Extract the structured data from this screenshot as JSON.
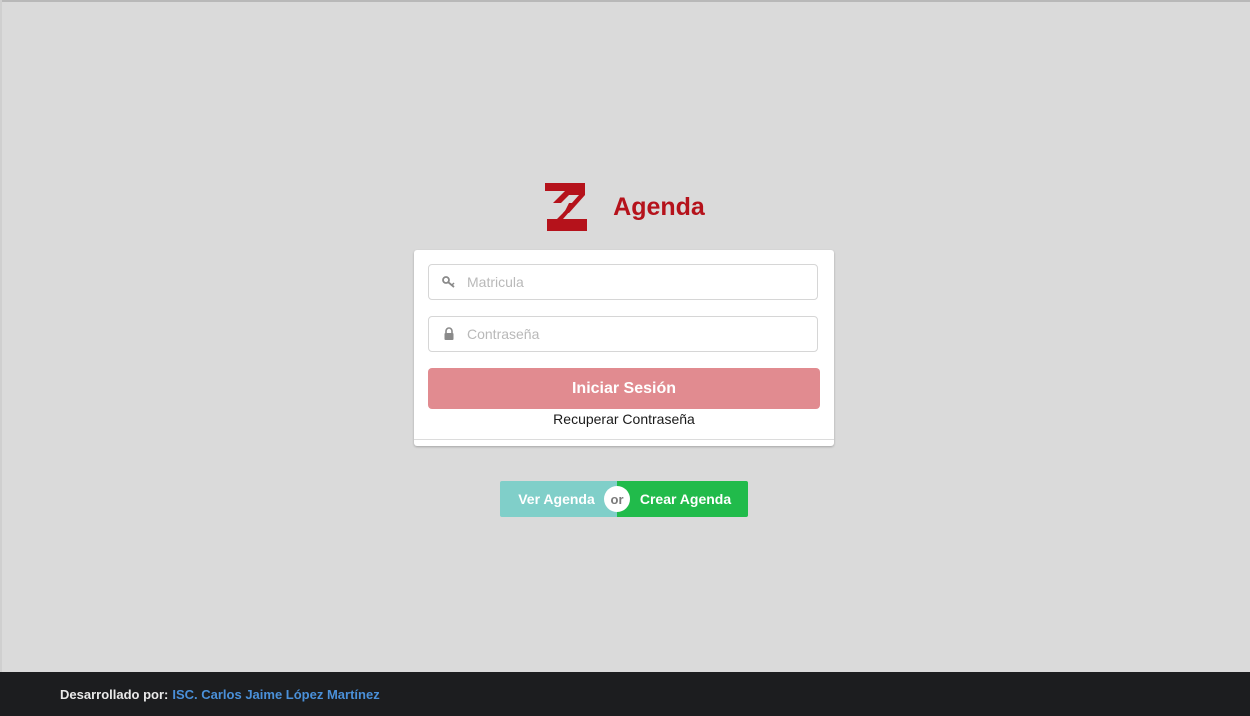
{
  "brand": {
    "logo_icon": "z-logo-icon",
    "title": "Agenda",
    "color": "#b5121b"
  },
  "login_form": {
    "matricula": {
      "icon": "key-icon",
      "placeholder": "Matricula",
      "value": ""
    },
    "password": {
      "icon": "lock-icon",
      "placeholder": "Contraseña",
      "value": ""
    },
    "submit_label": "Iniciar Sesión",
    "submit_color": "#e18b90",
    "recover_label": "Recuperar Contraseña"
  },
  "actions": {
    "view_label": "Ver Agenda",
    "view_color": "#80cfc9",
    "or_label": "or",
    "create_label": "Crear Agenda",
    "create_color": "#21bb4b"
  },
  "footer": {
    "prefix": "Desarrollado por:",
    "author": "ISC. Carlos Jaime López Martínez",
    "author_color": "#4a90d9"
  }
}
